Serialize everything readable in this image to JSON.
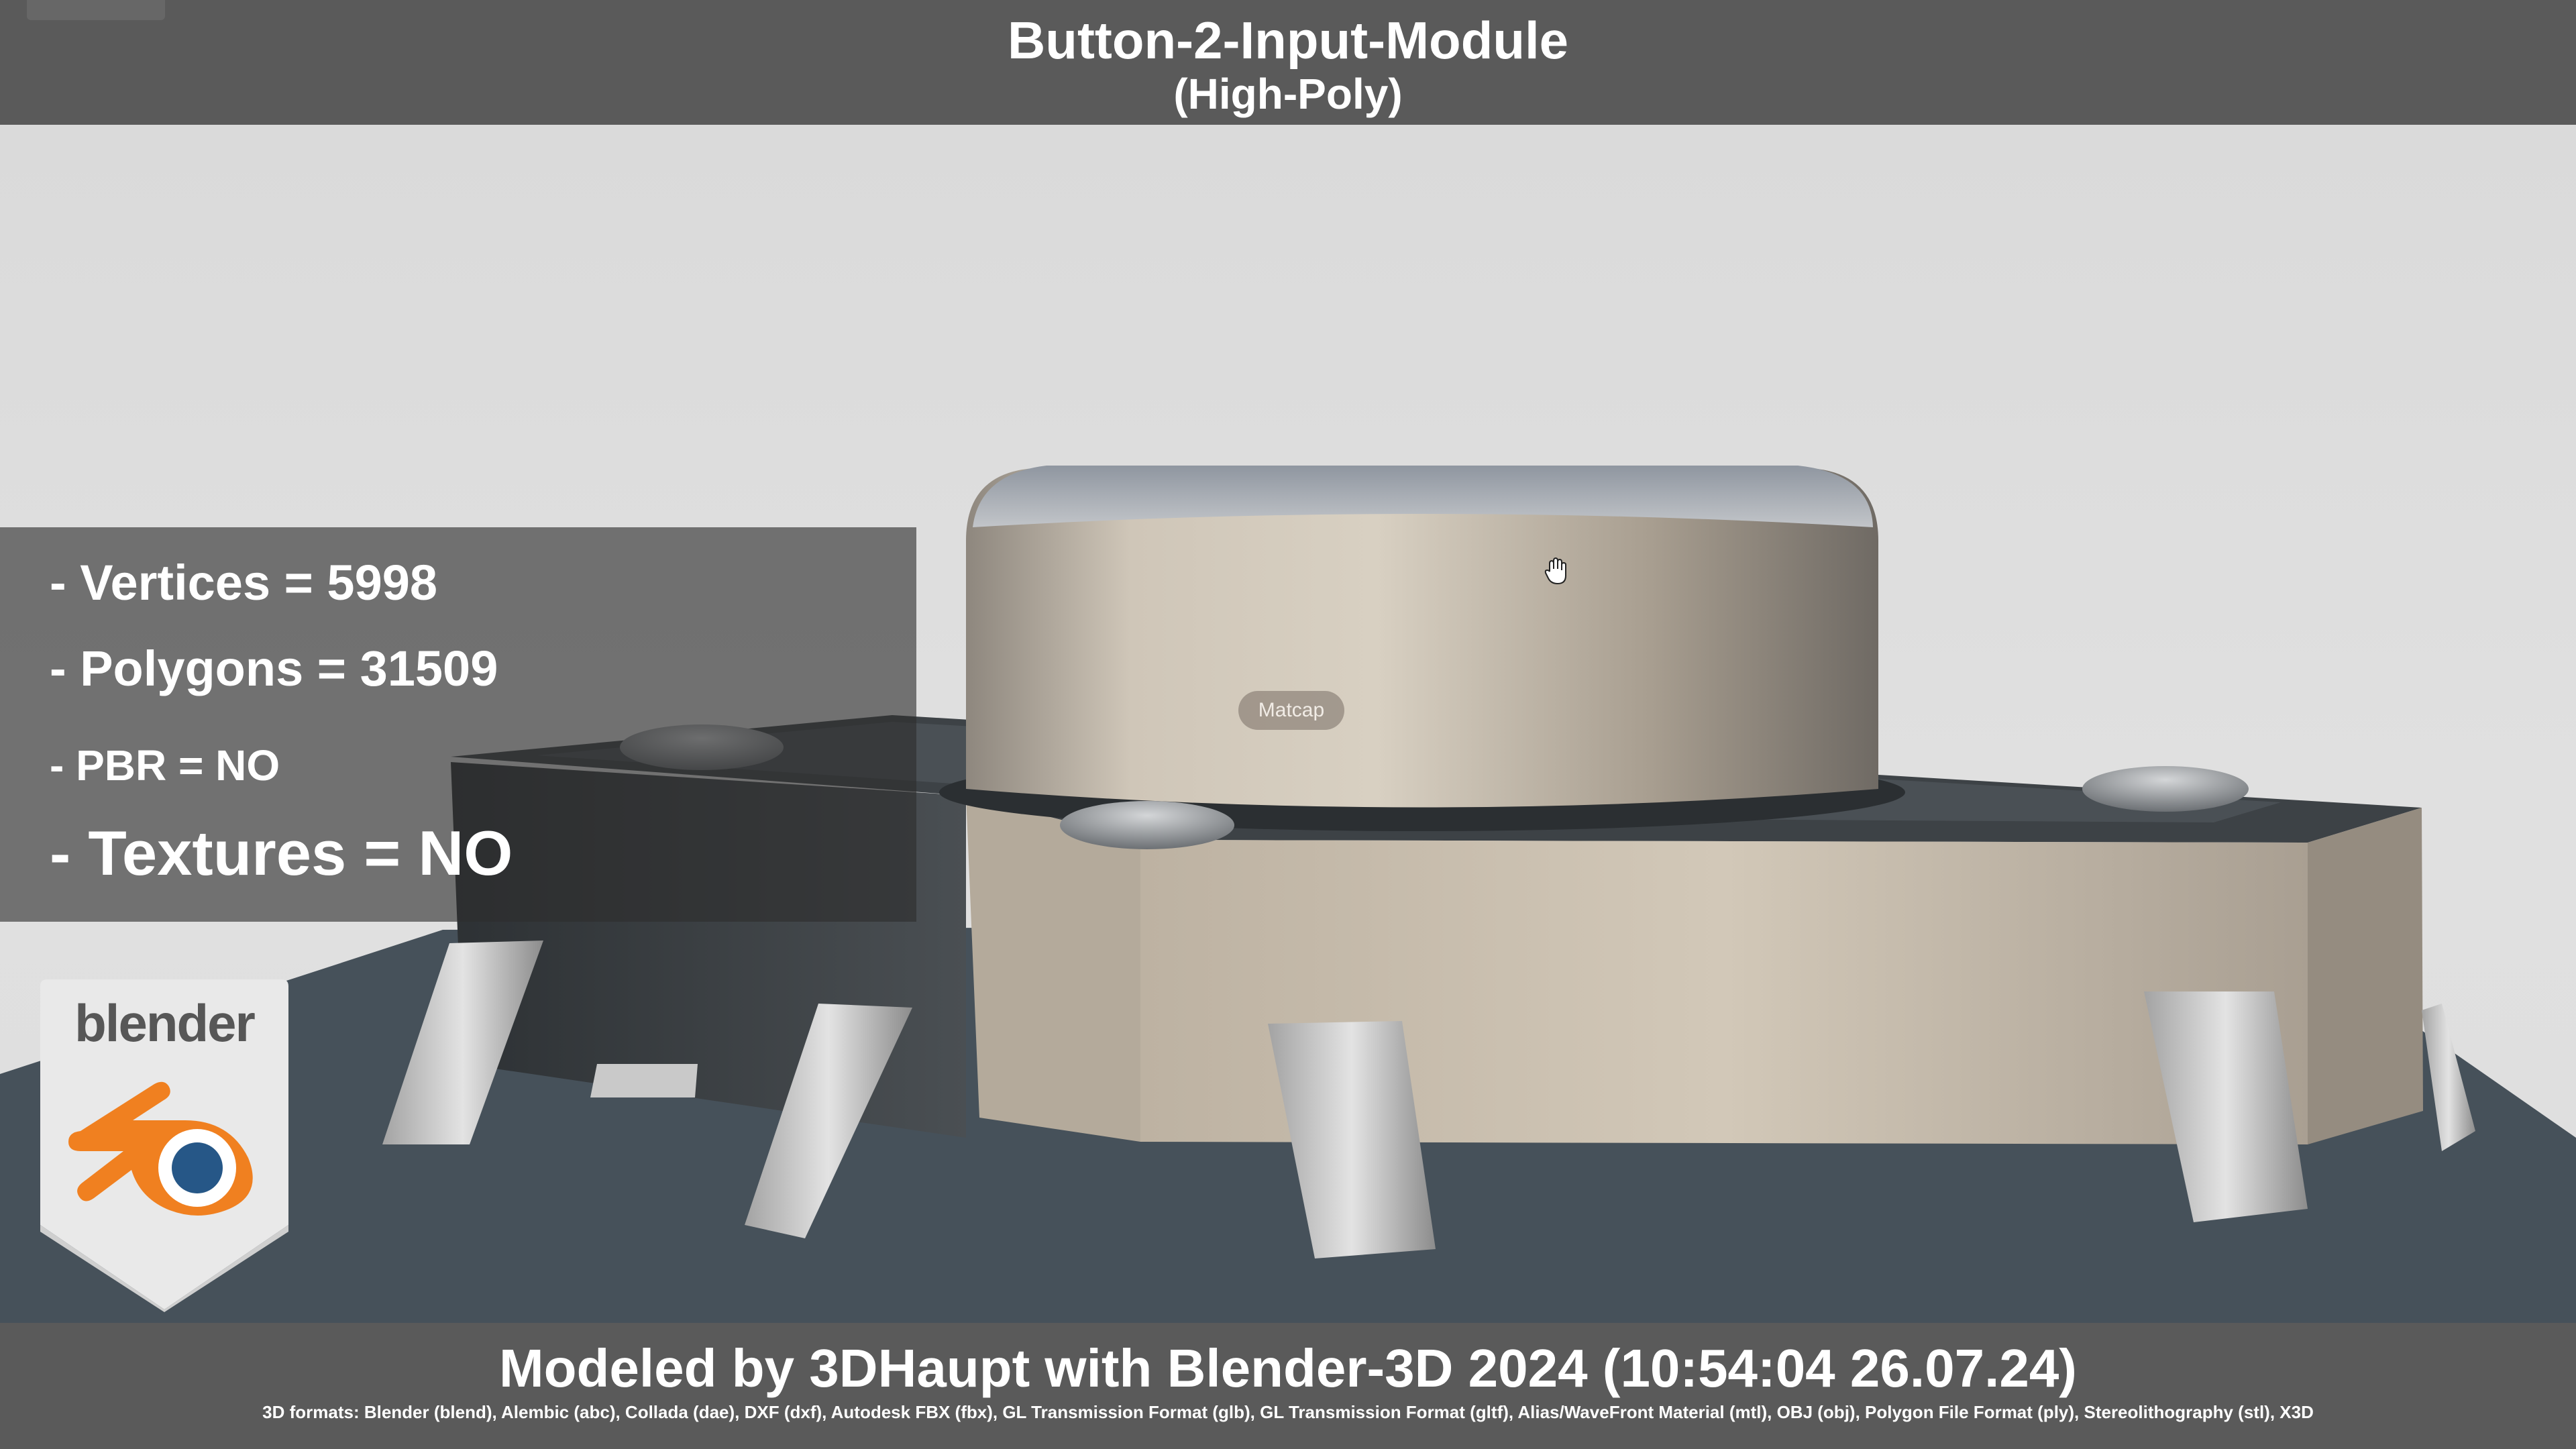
{
  "header": {
    "title": "Button-2-Input-Module",
    "subtitle": "(High-Poly)"
  },
  "stats": {
    "vertices": "- Vertices = 5998",
    "polygons": "- Polygons = 31509",
    "pbr": "- PBR =  NO",
    "textures": "- Textures = NO"
  },
  "viewport": {
    "shading_label": "Matcap",
    "cursor_icon": "hand-grab-icon"
  },
  "logo": {
    "wordmark": "blender",
    "icon": "blender-logo-icon"
  },
  "footer": {
    "credit": "Modeled by 3DHaupt with Blender-3D 2024 (10:54:04  26.07.24)",
    "formats": "3D formats: Blender (blend), Alembic (abc), Collada (dae), DXF (dxf), Autodesk FBX (fbx), GL Transmission Format (glb), GL Transmission Format (gltf), Alias/WaveFront Material (mtl), OBJ (obj), Polygon File Format (ply), Stereolithography (stl), X3D"
  },
  "colors": {
    "bar_background": "#5a5a5a",
    "viewport_background": "#dcdcdc",
    "shadow": "#46515a",
    "body_metal": "#cbbfae",
    "top_plate": "#3d4246",
    "blender_orange": "#f08020",
    "blender_blue": "#265787"
  }
}
